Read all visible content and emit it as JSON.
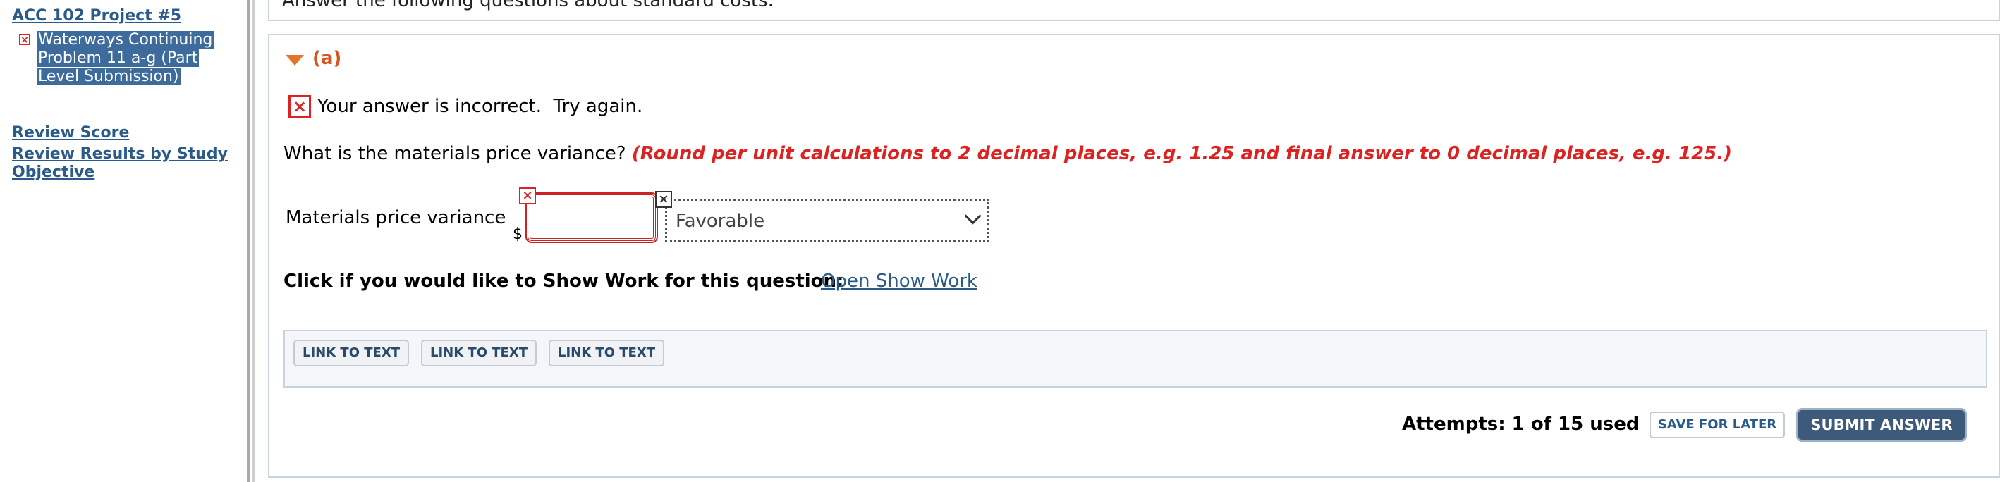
{
  "sidebar": {
    "project_title": "ACC 102 Project #5",
    "item_label": "Waterways Continuing Problem 11 a-g (Part Level Submission)",
    "item_status_icon": "x-icon",
    "links": [
      "Review Score",
      "Review Results by Study Objective"
    ]
  },
  "main": {
    "header_text": "Answer the following questions about standard costs.",
    "part_label": "(a)",
    "feedback": "Your answer is incorrect.  Try again.",
    "question": "What is the materials price variance?",
    "hint": "(Round per unit calculations to 2 decimal places, e.g. 1.25 and final answer to 0 decimal places, e.g. 125.)",
    "field_label": "Materials price variance",
    "currency": "$",
    "answer_value": "",
    "select_value": "Favorable",
    "show_work_label": "Click if you would like to Show Work for this question:",
    "show_work_link": "Open Show Work",
    "link_buttons": [
      "LINK TO TEXT",
      "LINK TO TEXT",
      "LINK TO TEXT"
    ],
    "attempts": "Attempts: 1 of 15 used",
    "save_label": "SAVE FOR LATER",
    "submit_label": "SUBMIT ANSWER"
  },
  "colors": {
    "link": "#2a5a8a",
    "error": "#dd2222",
    "accent_orange": "#d9531e",
    "submit_bg": "#3d5a7a"
  }
}
